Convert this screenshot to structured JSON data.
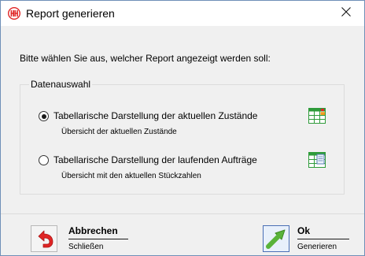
{
  "window": {
    "title": "Report generieren",
    "app_icon": "double-h-logo-icon",
    "close_icon": "close-icon"
  },
  "dialog": {
    "prompt": "Bitte wählen Sie aus, welcher Report angezeigt werden soll:",
    "group": {
      "legend": "Datenauswahl",
      "options": [
        {
          "label": "Tabellarische Darstellung der aktuellen Zustände",
          "description": "Übersicht der aktuellen Zustände",
          "selected": true,
          "icon": "table-status-icon"
        },
        {
          "label": "Tabellarische Darstellung der laufenden Aufträge",
          "description": "Übersicht mit den aktuellen Stückzahlen",
          "selected": false,
          "icon": "table-document-icon"
        }
      ]
    }
  },
  "footer": {
    "cancel": {
      "title": "Abbrechen",
      "subtitle": "Schließen",
      "icon": "undo-arrow-icon"
    },
    "ok": {
      "title": "Ok",
      "subtitle": "Generieren",
      "icon": "go-arrow-icon"
    }
  },
  "colors": {
    "accent_red": "#e02525",
    "grid_green": "#2e9b3a",
    "arrow_green": "#59b33a",
    "title_bar": "#ffffff",
    "dialog_bg": "#f0f0f0"
  }
}
